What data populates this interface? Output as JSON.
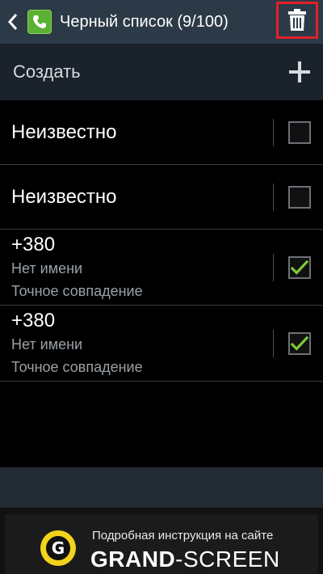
{
  "header": {
    "title": "Черный список (9/100)",
    "back_icon": "chevron-left-icon",
    "app_icon": "phone-icon",
    "delete_icon": "trash-icon",
    "highlight_color": "#e2202a"
  },
  "create": {
    "label": "Создать",
    "icon": "plus-icon"
  },
  "items": [
    {
      "title": "Неизвестно",
      "checked": false
    },
    {
      "title": "Неизвестно",
      "checked": false
    },
    {
      "title": "+380",
      "name": "Нет имени",
      "match": "Точное совпадение",
      "checked": true
    },
    {
      "title": "+380",
      "name": "Нет имени",
      "match": "Точное совпадение",
      "checked": true
    }
  ],
  "banner": {
    "subtitle": "Подробная инструкция на сайте",
    "brand_bold": "GRAND",
    "brand_rest": "-SCREEN",
    "logo_letter": "G"
  },
  "colors": {
    "check": "#7ec73a",
    "logo": "#f2d31b"
  }
}
